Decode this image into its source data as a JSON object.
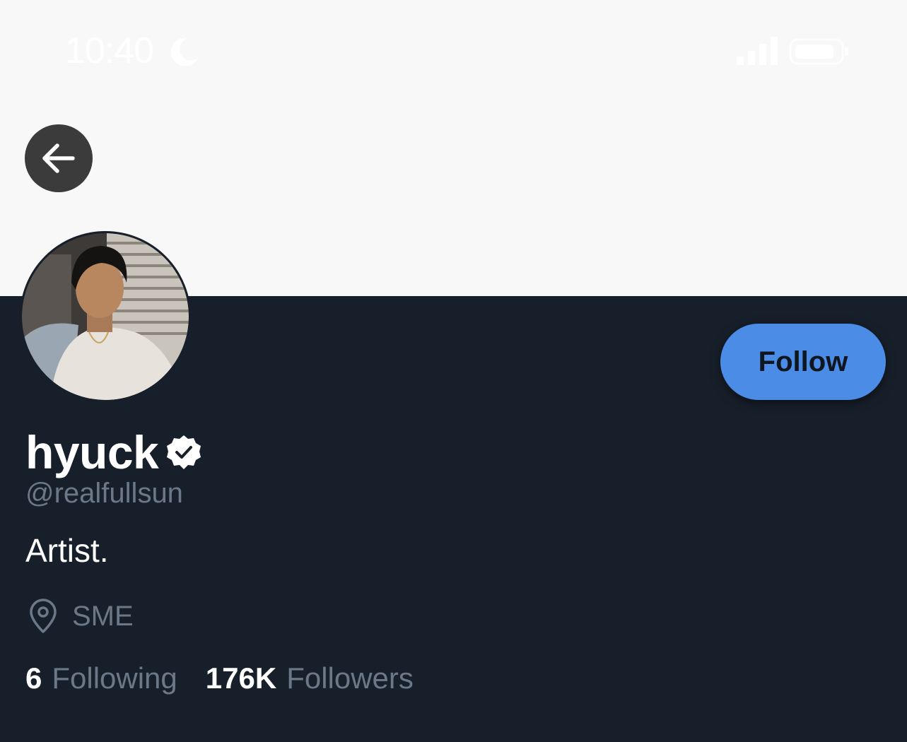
{
  "status_bar": {
    "time": "10:40",
    "icons": [
      "moon-icon",
      "signal-icon",
      "battery-icon"
    ]
  },
  "header": {
    "back_icon": "arrow-left-icon",
    "banner_color": "#f8f8f8"
  },
  "profile": {
    "display_name": "hyuck",
    "verified": true,
    "handle": "@realfullsun",
    "bio": "Artist.",
    "location": "SME",
    "follow_label": "Follow",
    "stats": {
      "following_count": "6",
      "following_label": "Following",
      "followers_count": "176K",
      "followers_label": "Followers"
    }
  },
  "colors": {
    "background": "#171f2a",
    "accent": "#4a8ce6",
    "muted_text": "#6b7888",
    "text": "#ffffff"
  }
}
